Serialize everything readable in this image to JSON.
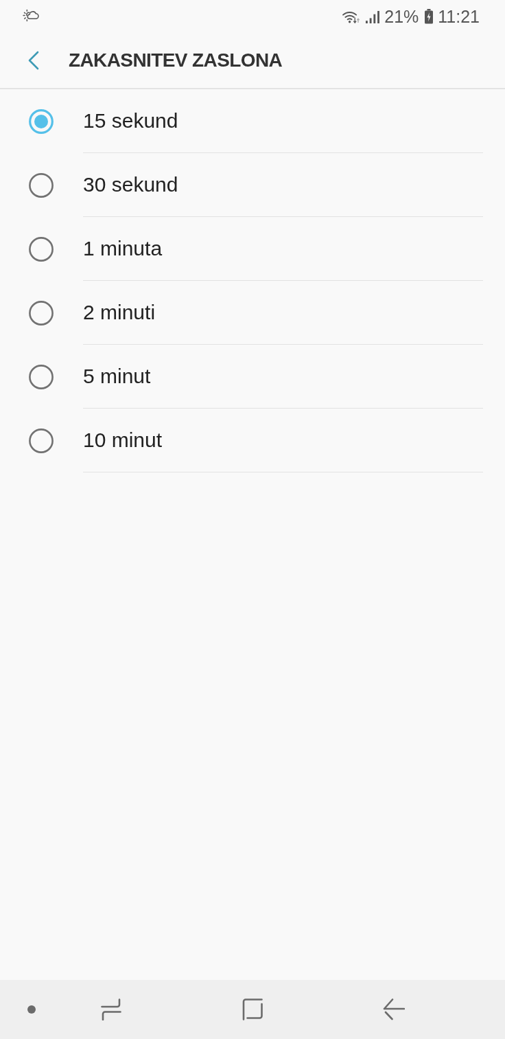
{
  "status_bar": {
    "battery": "21%",
    "time": "11:21"
  },
  "header": {
    "title": "ZAKASNITEV ZASLONA"
  },
  "options": [
    {
      "label": "15 sekund",
      "selected": true
    },
    {
      "label": "30 sekund",
      "selected": false
    },
    {
      "label": "1 minuta",
      "selected": false
    },
    {
      "label": "2 minuti",
      "selected": false
    },
    {
      "label": "5 minut",
      "selected": false
    },
    {
      "label": "10 minut",
      "selected": false
    }
  ]
}
